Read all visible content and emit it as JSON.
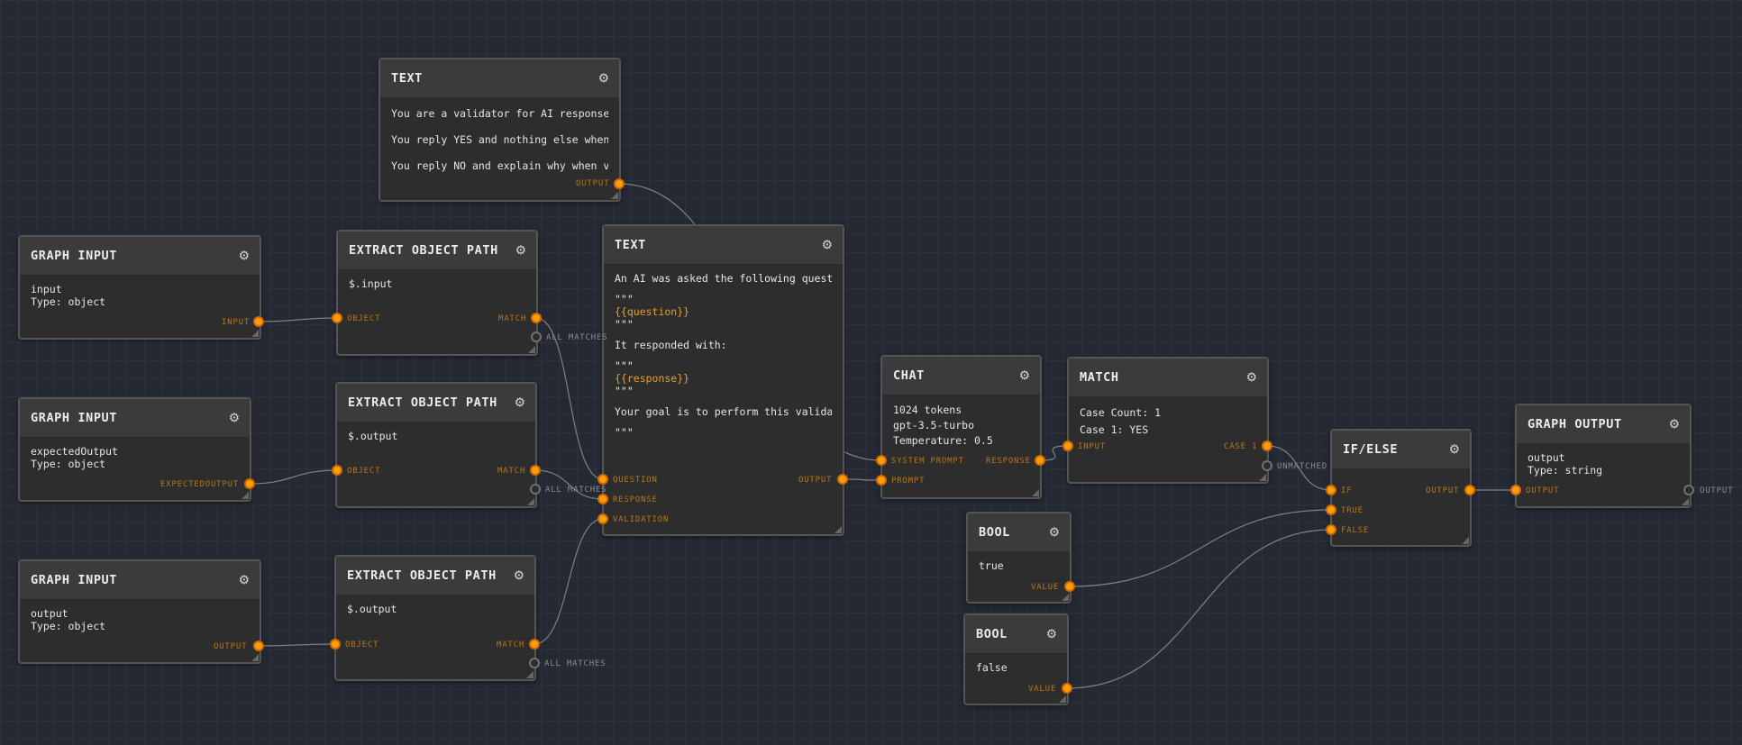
{
  "nodes": {
    "text_validator": {
      "title": "TEXT",
      "lines": [
        "You are a validator for AI responses.",
        "You reply YES and nothing else when valid.",
        "You reply NO and explain why when valid."
      ],
      "ports": {
        "output": "OUTPUT"
      }
    },
    "graph_input_1": {
      "title": "GRAPH INPUT",
      "lines": [
        "input",
        "Type: object"
      ],
      "ports": {
        "output": "INPUT"
      }
    },
    "graph_input_2": {
      "title": "GRAPH INPUT",
      "lines": [
        "expectedOutput",
        "Type: object"
      ],
      "ports": {
        "output": "EXPECTEDOUTPUT"
      }
    },
    "graph_input_3": {
      "title": "GRAPH INPUT",
      "lines": [
        "output",
        "Type: object"
      ],
      "ports": {
        "output": "OUTPUT"
      }
    },
    "extract_1": {
      "title": "EXTRACT OBJECT PATH",
      "path": "$.input",
      "ports": {
        "object": "OBJECT",
        "match": "MATCH",
        "all_matches": "ALL MATCHES"
      }
    },
    "extract_2": {
      "title": "EXTRACT OBJECT PATH",
      "path": "$.output",
      "ports": {
        "object": "OBJECT",
        "match": "MATCH",
        "all_matches": "ALL MATCHES"
      }
    },
    "extract_3": {
      "title": "EXTRACT OBJECT PATH",
      "path": "$.output",
      "ports": {
        "object": "OBJECT",
        "match": "MATCH",
        "all_matches": "ALL MATCHES"
      }
    },
    "text_prompt": {
      "title": "TEXT",
      "lines": [
        "An AI was asked the following question:",
        "\"\"\"",
        "{{question}}",
        "\"\"\"",
        "It responded with:",
        "\"\"\"",
        "{{response}}",
        "\"\"\"",
        "Your goal is to perform this validation:",
        "\"\"\""
      ],
      "ports": {
        "question": "QUESTION",
        "response": "RESPONSE",
        "validation": "VALIDATION",
        "output": "OUTPUT"
      }
    },
    "chat": {
      "title": "CHAT",
      "lines": [
        "1024 tokens",
        "gpt-3.5-turbo",
        "Temperature: 0.5"
      ],
      "ports": {
        "system_prompt": "SYSTEM PROMPT",
        "prompt": "PROMPT",
        "response": "RESPONSE"
      }
    },
    "match": {
      "title": "MATCH",
      "lines": [
        "Case Count: 1",
        "Case 1: YES"
      ],
      "ports": {
        "input": "INPUT",
        "case1": "CASE 1",
        "unmatched": "UNMATCHED"
      }
    },
    "bool_true": {
      "title": "BOOL",
      "value": "true",
      "ports": {
        "value": "VALUE"
      }
    },
    "bool_false": {
      "title": "BOOL",
      "value": "false",
      "ports": {
        "value": "VALUE"
      }
    },
    "ifelse": {
      "title": "IF/ELSE",
      "ports": {
        "if": "IF",
        "true": "TRUE",
        "false": "FALSE",
        "output": "OUTPUT"
      }
    },
    "graph_output": {
      "title": "GRAPH OUTPUT",
      "lines": [
        "output",
        "Type: string"
      ],
      "ports": {
        "input": "OUTPUT",
        "output": "OUTPUT"
      }
    }
  },
  "icons": {
    "settings": "gear-icon"
  },
  "colors": {
    "background": "#252933",
    "port": "#ff9d0a",
    "port_label": "#b87618",
    "wire": "#8c8f96"
  }
}
